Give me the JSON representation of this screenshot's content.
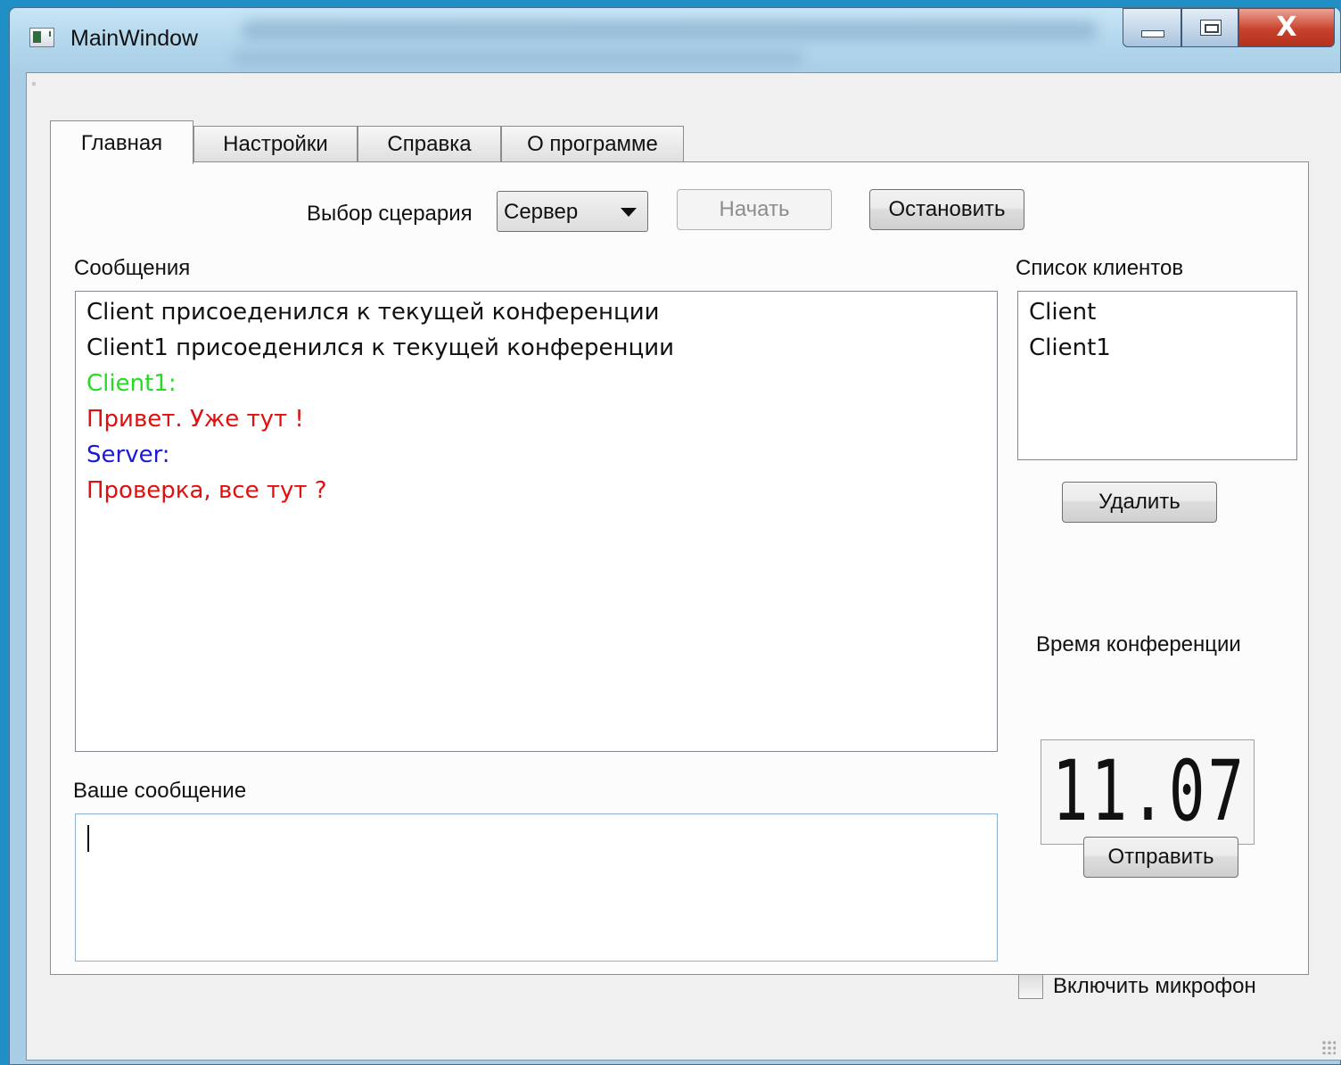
{
  "window": {
    "title": "MainWindow",
    "controls": {
      "minimize": "minimize",
      "maximize": "maximize",
      "close": "X"
    }
  },
  "tabs": [
    {
      "label": "Главная",
      "active": true
    },
    {
      "label": "Настройки",
      "active": false
    },
    {
      "label": "Справка",
      "active": false
    },
    {
      "label": "О программе",
      "active": false
    }
  ],
  "scenario": {
    "label": "Выбор сцерария",
    "selected": "Сервер",
    "start_label": "Начать",
    "stop_label": "Остановить"
  },
  "messages": {
    "label": "Сообщения",
    "lines": [
      {
        "text": "Client присоеденился к текущей конференции",
        "color": "#111111"
      },
      {
        "text": "Client1 присоеденился к текущей конференции",
        "color": "#111111"
      },
      {
        "text": "Client1:",
        "color": "#22dd22"
      },
      {
        "text": "Привет. Уже тут !",
        "color": "#e01010"
      },
      {
        "text": "Server:",
        "color": "#1a1ad8"
      },
      {
        "text": "Проверка, все тут ?",
        "color": "#e01010"
      }
    ]
  },
  "clients": {
    "label": "Список клиентов",
    "items": [
      "Client",
      "Client1"
    ],
    "delete_label": "Удалить"
  },
  "conference_time": {
    "label": "Время конференции",
    "value": "11.07"
  },
  "compose": {
    "label": "Ваше сообщение",
    "value": "",
    "send_label": "Отправить"
  },
  "microphone": {
    "label": "Включить микрофон",
    "checked": false
  }
}
